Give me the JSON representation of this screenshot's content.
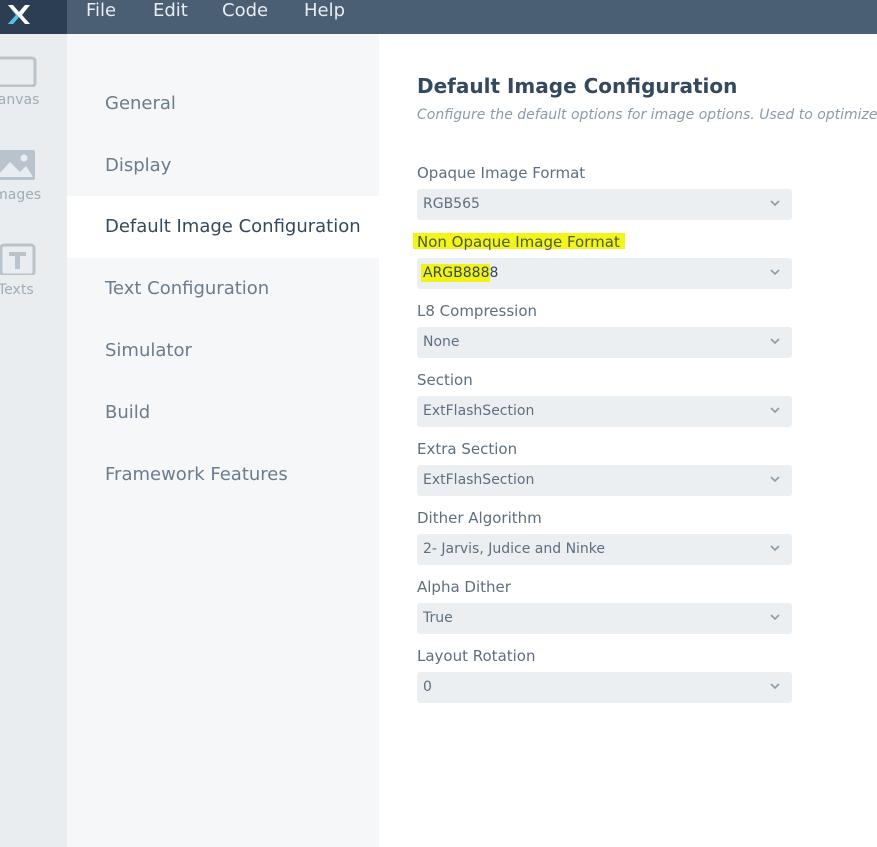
{
  "menubar": {
    "items": [
      "File",
      "Edit",
      "Code",
      "Help"
    ]
  },
  "rail": {
    "items": [
      {
        "label": "Canvas",
        "icon": "canvas-icon"
      },
      {
        "label": "Images",
        "icon": "images-icon"
      },
      {
        "label": "Texts",
        "icon": "texts-icon"
      }
    ]
  },
  "nav": {
    "items": [
      "General",
      "Display",
      "Default Image Configuration",
      "Text Configuration",
      "Simulator",
      "Build",
      "Framework Features"
    ],
    "active": "Default Image Configuration"
  },
  "content": {
    "title": "Default Image Configuration",
    "subtitle": "Configure the default options for image options. Used to optimize memory",
    "fields": [
      {
        "label": "Opaque Image Format",
        "value": "RGB565"
      },
      {
        "label": "Non Opaque Image Format",
        "value": "ARGB8888"
      },
      {
        "label": "L8 Compression",
        "value": "None"
      },
      {
        "label": "Section",
        "value": "ExtFlashSection"
      },
      {
        "label": "Extra Section",
        "value": "ExtFlashSection"
      },
      {
        "label": "Dither Algorithm",
        "value": "2- Jarvis, Judice and Ninke"
      },
      {
        "label": "Alpha Dither",
        "value": "True"
      },
      {
        "label": "Layout Rotation",
        "value": "0"
      }
    ]
  },
  "colors": {
    "menubar": "#4a5e74",
    "logo_bg": "#2c3e53",
    "highlight": "#f4f41a",
    "active_nav": "#ffffff"
  }
}
